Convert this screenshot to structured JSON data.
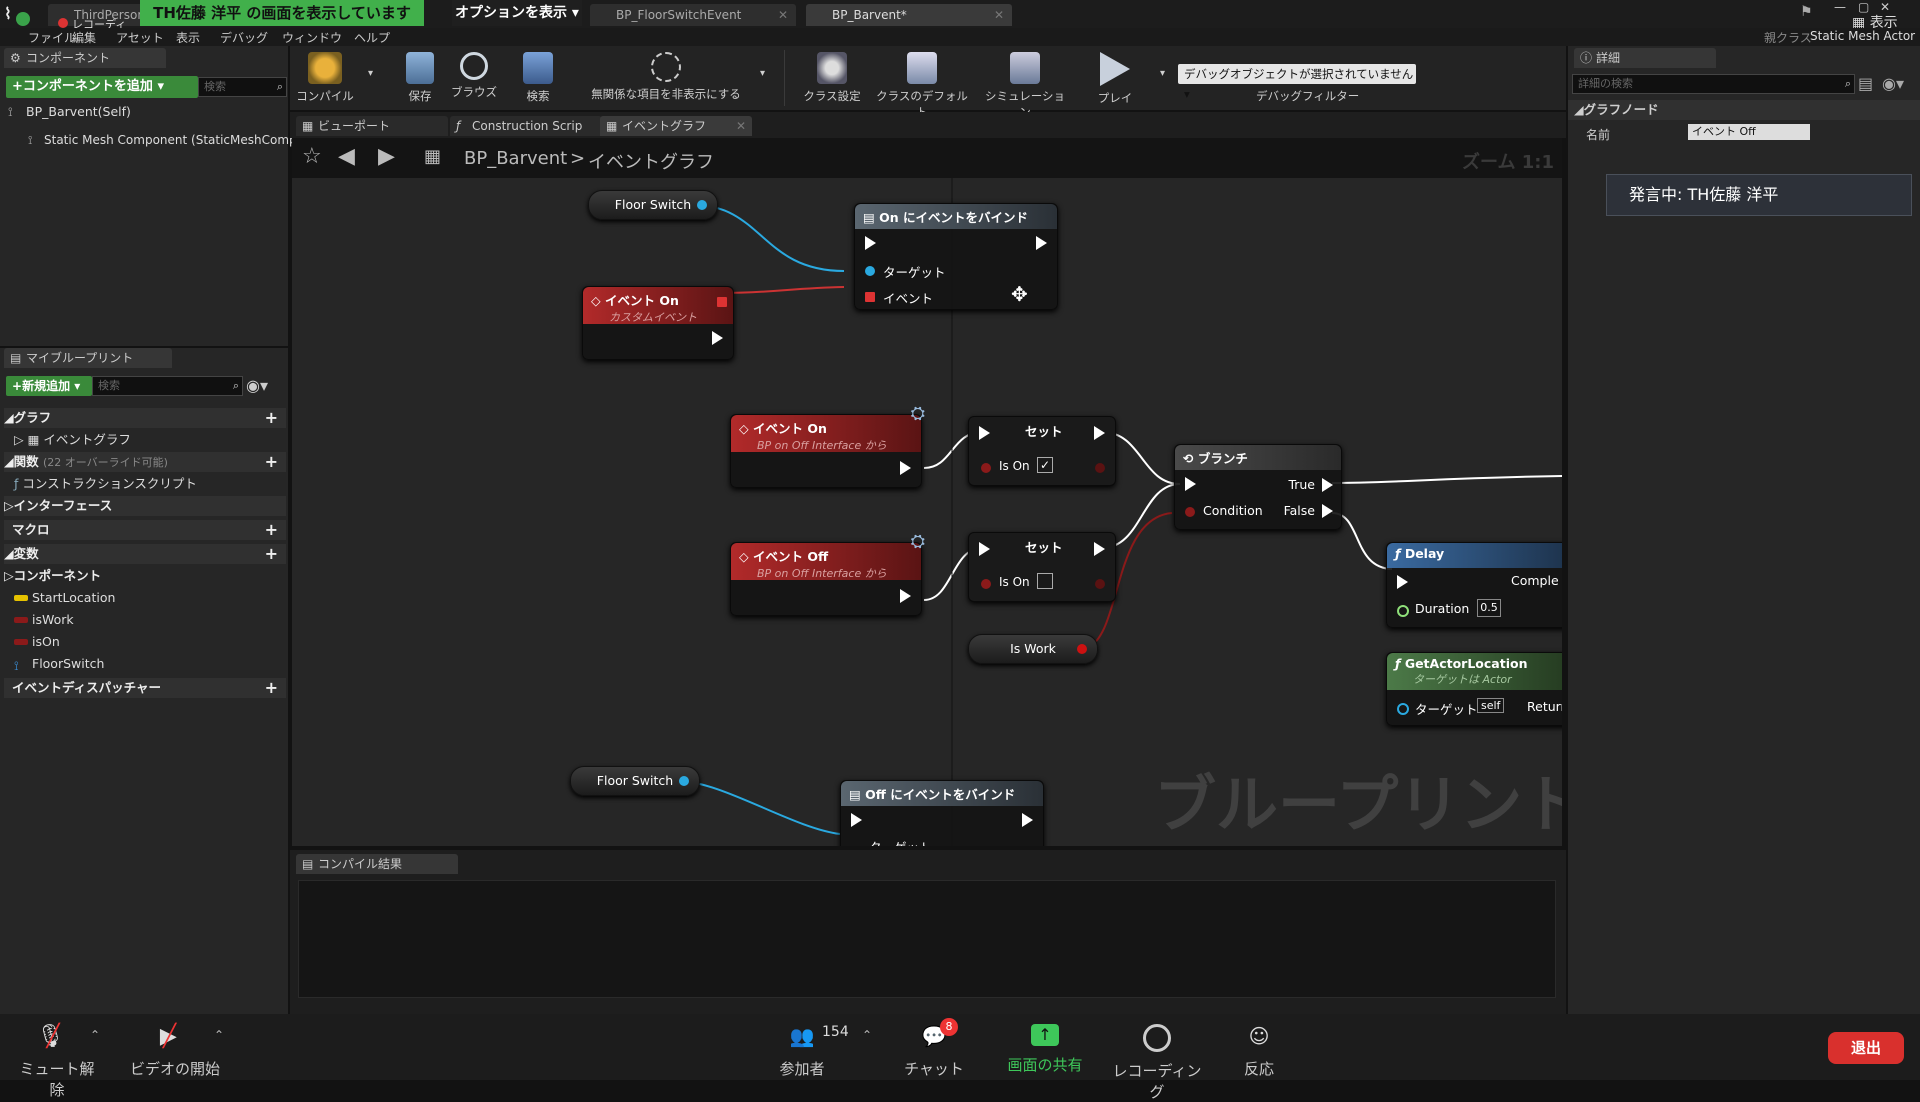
{
  "zoom_top": {
    "share_banner": "TH佐藤 洋平 の画面を表示しています",
    "options_label": "オプションを表示",
    "recording_label": "レコーディ"
  },
  "window": {
    "tabs": [
      {
        "label": "ThirdPersonEx"
      },
      {
        "label": "BP_FloorSwitchEvent"
      },
      {
        "label": "BP_Barvent*"
      }
    ],
    "parent_class_label": "親クラス",
    "parent_class_value": "Static Mesh Actor",
    "display_label": "表示"
  },
  "menu": [
    "ファイル",
    "編集",
    "アセット",
    "表示",
    "デバッグ",
    "ウィンドウ",
    "ヘルプ"
  ],
  "toolbar": {
    "buttons": [
      "コンパイル",
      "保存",
      "ブラウズ",
      "検索",
      "無関係な項目を非表示にする",
      "クラス設定",
      "クラスのデフォルト",
      "シミュレーション",
      "プレイ"
    ],
    "debug_select": "デバッグオブジェクトが選択されていません",
    "debug_filter": "デバッグフィルター"
  },
  "components_panel": {
    "tab": "コンポーネント",
    "add_button": "コンポーネントを追加",
    "search_placeholder": "検索",
    "items": [
      "BP_Barvent(Self)",
      "Static Mesh Component (StaticMeshCompor"
    ]
  },
  "editor_tabs": [
    "ビューポート",
    "Construction Scrip",
    "イベントグラフ"
  ],
  "breadcrumb": {
    "root": "BP_Barvent",
    "sep": ">",
    "current": "イベントグラフ",
    "zoom": "ズーム 1:1"
  },
  "my_blueprint": {
    "tab": "マイブループリント",
    "new_button": "新規追加",
    "search_placeholder": "検索",
    "rows": {
      "graph": "グラフ",
      "event_graph": "イベントグラフ",
      "functions": "関数",
      "functions_note": "(22 オーバーライド可能)",
      "construction": "コンストラクションスクリプト",
      "interfaces": "インターフェース",
      "macros": "マクロ",
      "variables": "変数",
      "components": "コンポーネント",
      "var_startlocation": "StartLocation",
      "var_iswork": "isWork",
      "var_ison": "isOn",
      "var_floorswitch": "FloorSwitch",
      "dispatchers": "イベントディスパッチャー"
    }
  },
  "graph": {
    "watermark": "ブループリント",
    "floor_switch_1": "Floor Switch",
    "floor_switch_2": "Floor Switch",
    "bind_on": {
      "title": "On にイベントをバインド",
      "target": "ターゲット",
      "event": "イベント"
    },
    "custom_event": {
      "title": "イベント On",
      "subtitle": "カスタムイベント"
    },
    "event_on": {
      "title": "イベント On",
      "subtitle": "BP on Off Interface から"
    },
    "event_off": {
      "title": "イベント Off",
      "subtitle": "BP on Off Interface から"
    },
    "set_1": {
      "title": "セット",
      "pin": "Is On"
    },
    "set_2": {
      "title": "セット",
      "pin": "Is On"
    },
    "is_work": "Is Work",
    "branch": {
      "title": "ブランチ",
      "condition": "Condition",
      "true": "True",
      "false": "False"
    },
    "delay": {
      "title": "Delay",
      "completed": "Comple",
      "duration": "Duration",
      "duration_value": "0.5"
    },
    "get_actor_location": {
      "title": "GetActorLocation",
      "subtitle": "ターゲットは Actor",
      "target": "ターゲット",
      "self": "self",
      "return": "Returr"
    },
    "bind_off": {
      "title": "Off にイベントをバインド",
      "target": "ターゲット"
    }
  },
  "compile_results": {
    "tab": "コンパイル結果"
  },
  "details": {
    "tab": "詳細",
    "search_placeholder": "詳細の検索",
    "section": "グラフノード",
    "name_label": "名前",
    "name_value": "イベント Off",
    "speaking": "発言中: TH佐藤 洋平"
  },
  "zoom_bar": {
    "unmute": "ミュート解除",
    "start_video": "ビデオの開始",
    "participants": "参加者",
    "participants_count": "154",
    "chat": "チャット",
    "chat_badge": "8",
    "share_screen": "画面の共有",
    "recording": "レコーディング",
    "reactions": "反応",
    "leave": "退出"
  }
}
